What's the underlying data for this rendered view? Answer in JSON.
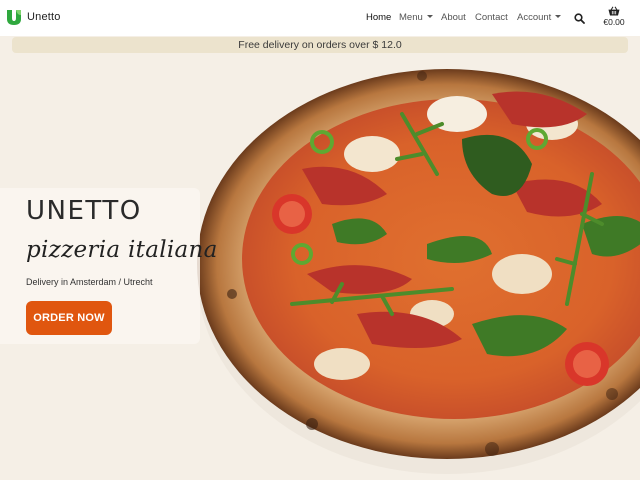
{
  "brand": {
    "name": "Unetto",
    "logo_icon": "u-leaf-logo",
    "logo_color": "#2fa83e"
  },
  "nav": {
    "items": [
      {
        "label": "Home",
        "active": true
      },
      {
        "label": "Menu",
        "dropdown": true
      },
      {
        "label": "About"
      },
      {
        "label": "Contact"
      },
      {
        "label": "Account",
        "dropdown": true
      }
    ],
    "search_icon": "search-icon",
    "cart": {
      "icon": "basket-icon",
      "total": "€0.00"
    }
  },
  "promo": {
    "text": "Free delivery on orders over $ 12.0"
  },
  "hero": {
    "title": "UNETTO",
    "subtitle": "pizzeria italiana",
    "tagline": "Delivery in Amsterdam / Utrecht",
    "cta_label": "ORDER NOW",
    "cta_color": "#e0560f",
    "image": "pizza"
  }
}
